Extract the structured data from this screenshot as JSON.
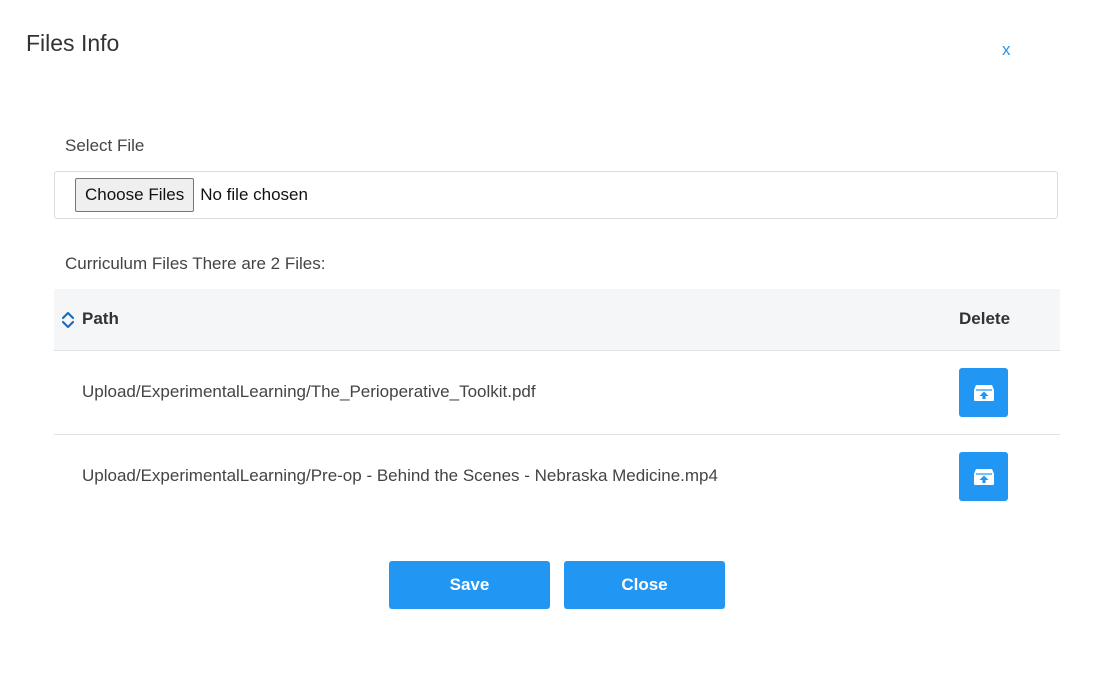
{
  "dialog": {
    "title": "Files Info",
    "close_x": "x"
  },
  "upload": {
    "label": "Select File",
    "choose_button": "Choose Files",
    "status": "No file chosen"
  },
  "files": {
    "summary": "Curriculum Files There are 2 Files:",
    "columns": {
      "path": "Path",
      "delete": "Delete"
    },
    "rows": [
      {
        "path": "Upload/ExperimentalLearning/The_Perioperative_Toolkit.pdf",
        "delete_icon": "archive-upload-icon"
      },
      {
        "path": "Upload/ExperimentalLearning/Pre-op - Behind the Scenes - Nebraska Medicine.mp4",
        "delete_icon": "archive-upload-icon"
      }
    ]
  },
  "footer": {
    "save_label": "Save",
    "close_label": "Close"
  },
  "colors": {
    "accent": "#2196f3",
    "header_bg": "#f5f6f8",
    "sort_icon": "#1e6fb8"
  }
}
